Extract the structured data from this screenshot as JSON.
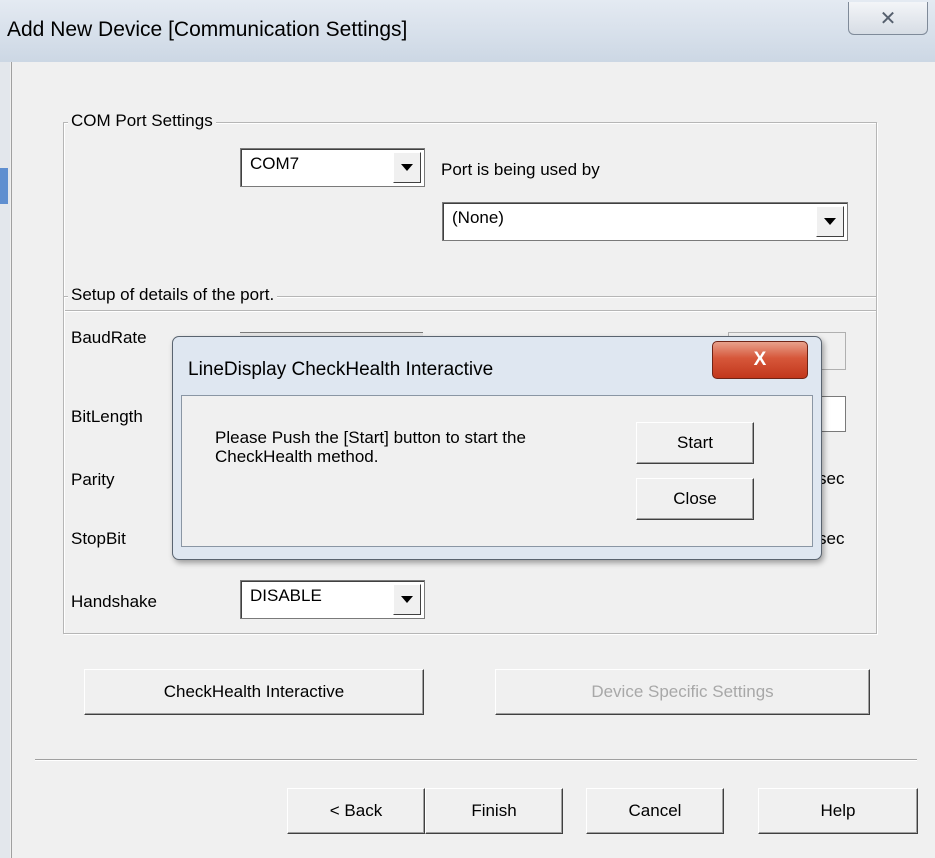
{
  "window": {
    "title": "Add New Device  [Communication Settings]",
    "close_glyph": "✕"
  },
  "com_group": {
    "legend": "COM Port Settings",
    "port_value": "COM7",
    "used_by_label": "Port is being used by",
    "used_by_value": "(None)"
  },
  "port_group": {
    "legend": "Setup of details of the port.",
    "labels": {
      "baudrate": "BaudRate",
      "bitlength": "BitLength",
      "parity": "Parity",
      "stopbit": "StopBit",
      "handshake": "Handshake"
    },
    "handshake_value": "DISABLE",
    "sec_unit": "sec"
  },
  "actions": {
    "checkhealth": "CheckHealth Interactive",
    "device_specific": "Device Specific Settings"
  },
  "footer": {
    "back": "< Back",
    "finish": "Finish",
    "cancel": "Cancel",
    "help": "Help"
  },
  "dialog": {
    "title": "LineDisplay  CheckHealth Interactive",
    "message": "Please Push the [Start] button to start the CheckHealth method.",
    "start": "Start",
    "close": "Close",
    "close_glyph": "X"
  }
}
